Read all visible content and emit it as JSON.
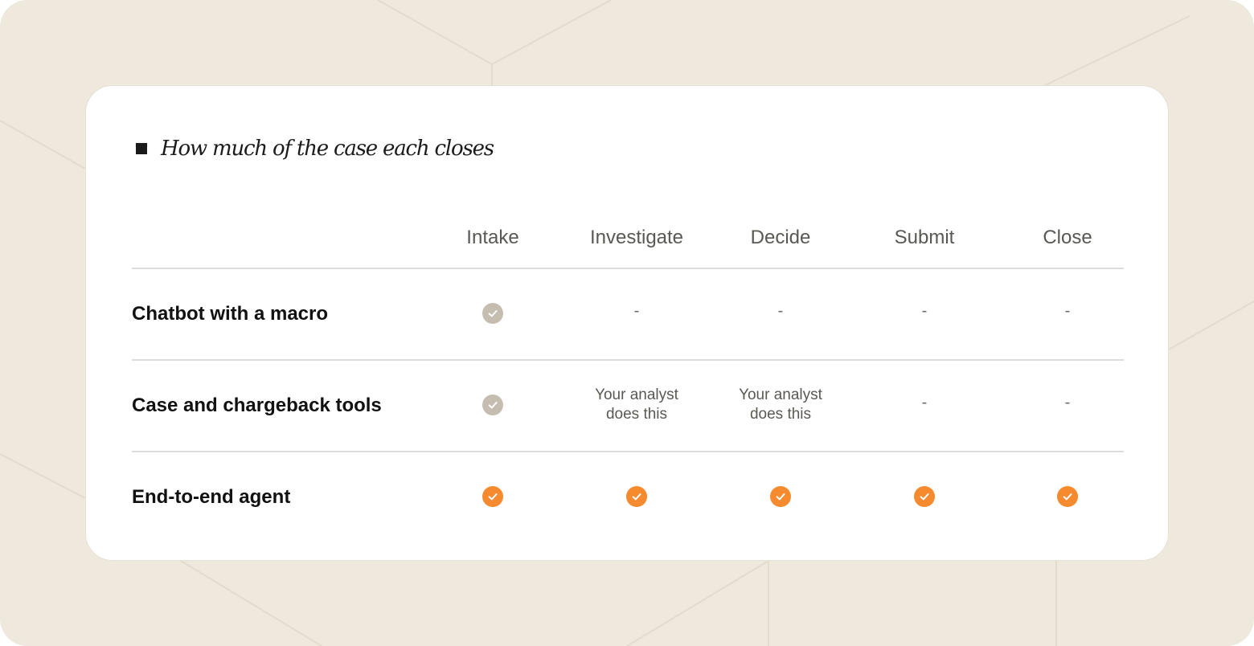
{
  "title": "How much of the case each closes",
  "columns": [
    "Intake",
    "Investigate",
    "Decide",
    "Submit",
    "Close"
  ],
  "rows": [
    {
      "label": "Chatbot with a macro",
      "cells": [
        {
          "kind": "check",
          "color": "#C5BDB0",
          "icon": "check-icon",
          "text": null
        },
        {
          "kind": "dash",
          "text": "-"
        },
        {
          "kind": "dash",
          "text": "-"
        },
        {
          "kind": "dash",
          "text": "-"
        },
        {
          "kind": "dash",
          "text": "-"
        }
      ]
    },
    {
      "label": "Case and chargeback tools",
      "cells": [
        {
          "kind": "check",
          "color": "#C5BDB0",
          "icon": "check-icon",
          "text": null
        },
        {
          "kind": "note",
          "text": "Your analyst does this"
        },
        {
          "kind": "note",
          "text": "Your analyst does this"
        },
        {
          "kind": "dash",
          "text": "-"
        },
        {
          "kind": "dash",
          "text": "-"
        }
      ]
    },
    {
      "label": "End-to-end agent",
      "cells": [
        {
          "kind": "check",
          "color": "#F58A2E",
          "icon": "check-icon",
          "text": null
        },
        {
          "kind": "check",
          "color": "#F58A2E",
          "icon": "check-icon",
          "text": null
        },
        {
          "kind": "check",
          "color": "#F58A2E",
          "icon": "check-icon",
          "text": null
        },
        {
          "kind": "check",
          "color": "#F58A2E",
          "icon": "check-icon",
          "text": null
        },
        {
          "kind": "check",
          "color": "#F58A2E",
          "icon": "check-icon",
          "text": null
        }
      ]
    }
  ],
  "colors": {
    "background": "#EEE8DD",
    "card": "#FFFFFF",
    "check_partial": "#C5BDB0",
    "check_full": "#F58A2E",
    "divider": "#DCDCDA"
  }
}
